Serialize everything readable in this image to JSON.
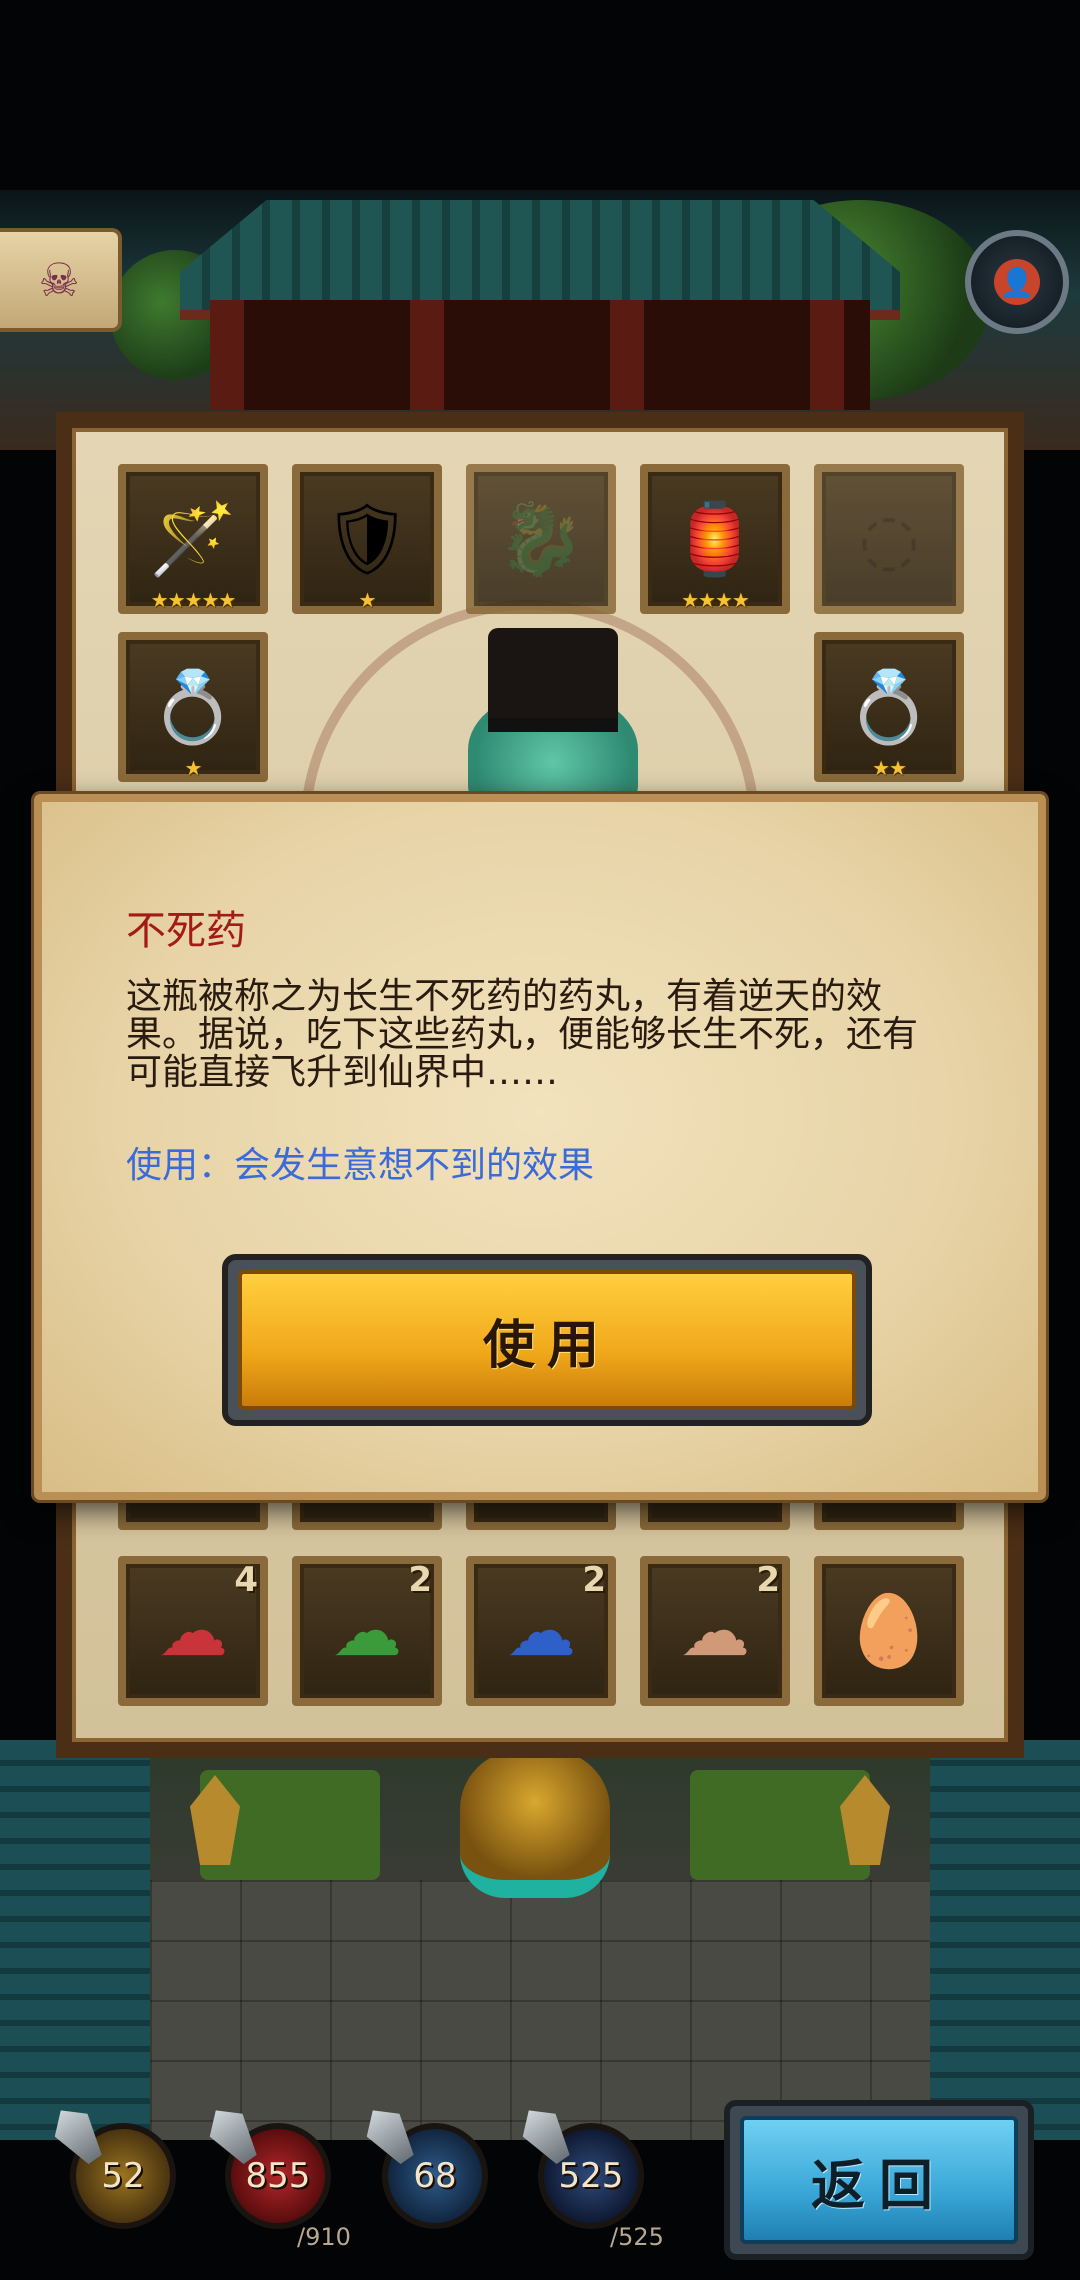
{
  "inventory": {
    "row1": [
      {
        "icon": "purple-wand-icon",
        "glyph": "🪄",
        "stars": "★★★★★"
      },
      {
        "icon": "armor-icon",
        "glyph": "🛡",
        "stars": "★"
      },
      {
        "icon": "locked-dragon-icon",
        "glyph": "🐉",
        "stars": ""
      },
      {
        "icon": "purple-lantern-icon",
        "glyph": "🏮",
        "stars": "★★★★"
      },
      {
        "icon": "locked-item-icon",
        "glyph": "◌",
        "stars": ""
      }
    ],
    "row2": [
      {
        "icon": "silver-bracelet-icon",
        "glyph": "💍",
        "stars": "★"
      },
      {
        "icon": "silver-ring-icon",
        "glyph": "💍",
        "stars": "★★"
      }
    ],
    "row_bottom": [
      {
        "icon": "red-cloud-icon",
        "glyph": "☁",
        "color": "#c8343a",
        "count": "4"
      },
      {
        "icon": "green-cloud-icon",
        "glyph": "☁",
        "color": "#3b9a3a",
        "count": "2"
      },
      {
        "icon": "blue-cloud-icon",
        "glyph": "☁",
        "color": "#2f5fc8",
        "count": "2"
      },
      {
        "icon": "tan-cloud-icon",
        "glyph": "☁",
        "color": "#d09a78",
        "count": "2"
      },
      {
        "icon": "egg-icon",
        "glyph": "🥚",
        "color": "#c9b6d8",
        "count": ""
      }
    ]
  },
  "dialog": {
    "title": "不死药",
    "description": "这瓶被称之为长生不死药的药丸，有着逆天的效果。据说，吃下这些药丸，便能够长生不死，还有可能直接飞升到仙界中……",
    "effect": "使用：会发生意想不到的效果",
    "use_label": "使用"
  },
  "hud": {
    "attack": "52",
    "hp": "855",
    "hp_max": "/910",
    "defense": "68",
    "mp": "525",
    "mp_max": "/525",
    "back_label": "返回"
  },
  "colors": {
    "title_red": "#a31b14",
    "effect_blue": "#3b6ad9",
    "use_button_gold": "#f0a81a",
    "back_button_blue": "#3aa7d8"
  }
}
